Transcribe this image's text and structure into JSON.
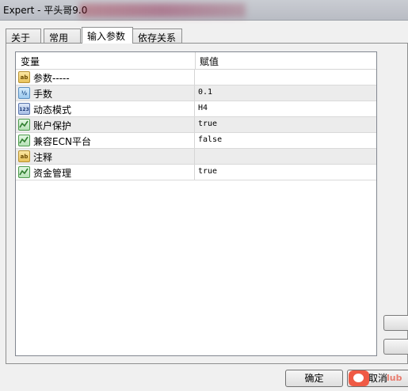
{
  "window": {
    "title": "Expert - 平头哥9.0"
  },
  "tabs": [
    {
      "label": "关于",
      "active": false
    },
    {
      "label": "常用",
      "active": false
    },
    {
      "label": "输入参数",
      "active": true
    },
    {
      "label": "依存关系",
      "active": false
    }
  ],
  "grid": {
    "headers": {
      "variable": "变量",
      "value": "赋值"
    },
    "rows": [
      {
        "icon": "text-type-icon",
        "name": "参数-----",
        "value": ""
      },
      {
        "icon": "double-type-icon",
        "name": "手数",
        "value": "0.1"
      },
      {
        "icon": "enum-type-icon",
        "name": "动态模式",
        "value": "H4"
      },
      {
        "icon": "bool-type-icon",
        "name": "账户保护",
        "value": "true"
      },
      {
        "icon": "bool-type-icon",
        "name": "兼容ECN平台",
        "value": "false"
      },
      {
        "icon": "text-type-icon",
        "name": "注释",
        "value": ""
      },
      {
        "icon": "bool-type-icon",
        "name": "资金管理",
        "value": "true"
      }
    ]
  },
  "buttons": {
    "ok": "确定",
    "cancel": "取消"
  },
  "watermark": {
    "text": "lub"
  }
}
